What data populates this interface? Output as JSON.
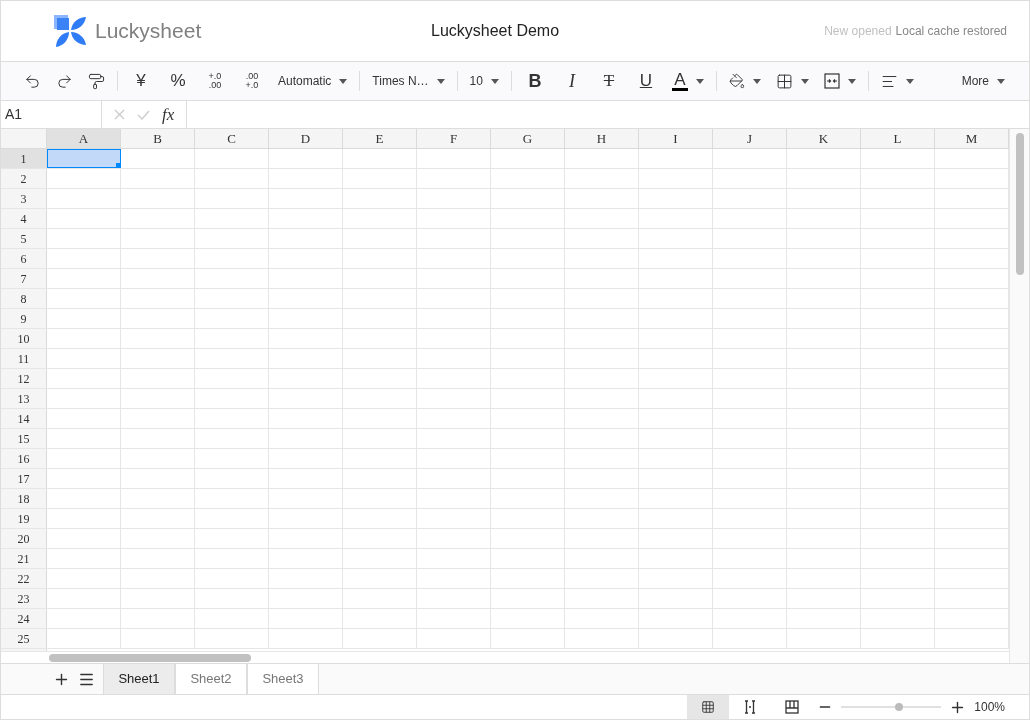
{
  "header": {
    "logo_text": "Luckysheet",
    "title": "Luckysheet Demo",
    "status_muted": "New opened",
    "status": "Local cache restored"
  },
  "toolbar": [
    {
      "kind": "undo"
    },
    {
      "kind": "redo"
    },
    {
      "kind": "painter"
    },
    {
      "kind": "sep"
    },
    {
      "kind": "char",
      "label": "¥"
    },
    {
      "kind": "char",
      "label": "%"
    },
    {
      "kind": "decimal",
      "top": "+.0",
      "bottom": ".00"
    },
    {
      "kind": "decimal",
      "top": ".00",
      "bottom": "+.0"
    },
    {
      "kind": "dropdown",
      "label": "Automatic"
    },
    {
      "kind": "sep"
    },
    {
      "kind": "dropdown",
      "label": "Times N…"
    },
    {
      "kind": "sep"
    },
    {
      "kind": "dropdown",
      "label": "10"
    },
    {
      "kind": "sep"
    },
    {
      "kind": "bold",
      "label": "B"
    },
    {
      "kind": "italic",
      "label": "I"
    },
    {
      "kind": "strike",
      "label": "T"
    },
    {
      "kind": "underline",
      "label": "U"
    },
    {
      "kind": "fontcolor",
      "label": "A",
      "color": "#000000"
    },
    {
      "kind": "sep"
    },
    {
      "kind": "fill"
    },
    {
      "kind": "border"
    },
    {
      "kind": "merge"
    },
    {
      "kind": "sep"
    },
    {
      "kind": "align"
    }
  ],
  "more": "More",
  "formula_bar": {
    "cell_ref": "A1",
    "fx": "fx"
  },
  "columns": [
    {
      "label": "A",
      "selected": true
    },
    {
      "label": "B",
      "selected": false
    },
    {
      "label": "C",
      "selected": false
    },
    {
      "label": "D",
      "selected": false
    },
    {
      "label": "E",
      "selected": false
    },
    {
      "label": "F",
      "selected": false
    },
    {
      "label": "G",
      "selected": false
    },
    {
      "label": "H",
      "selected": false
    },
    {
      "label": "I",
      "selected": false
    },
    {
      "label": "J",
      "selected": false
    },
    {
      "label": "K",
      "selected": false
    },
    {
      "label": "L",
      "selected": false
    },
    {
      "label": "M",
      "selected": false
    }
  ],
  "rows": [
    {
      "label": "1",
      "selected": true
    },
    {
      "label": "2",
      "selected": false
    },
    {
      "label": "3",
      "selected": false
    },
    {
      "label": "4",
      "selected": false
    },
    {
      "label": "5",
      "selected": false
    },
    {
      "label": "6",
      "selected": false
    },
    {
      "label": "7",
      "selected": false
    },
    {
      "label": "8",
      "selected": false
    },
    {
      "label": "9",
      "selected": false
    },
    {
      "label": "10",
      "selected": false
    },
    {
      "label": "11",
      "selected": false
    },
    {
      "label": "12",
      "selected": false
    },
    {
      "label": "13",
      "selected": false
    },
    {
      "label": "14",
      "selected": false
    },
    {
      "label": "15",
      "selected": false
    },
    {
      "label": "16",
      "selected": false
    },
    {
      "label": "17",
      "selected": false
    },
    {
      "label": "18",
      "selected": false
    },
    {
      "label": "19",
      "selected": false
    },
    {
      "label": "20",
      "selected": false
    },
    {
      "label": "21",
      "selected": false
    },
    {
      "label": "22",
      "selected": false
    },
    {
      "label": "23",
      "selected": false
    },
    {
      "label": "24",
      "selected": false
    },
    {
      "label": "25",
      "selected": false
    }
  ],
  "sheets": [
    {
      "label": "Sheet1",
      "selected": true
    },
    {
      "label": "Sheet2",
      "selected": false
    },
    {
      "label": "Sheet3",
      "selected": false
    }
  ],
  "status_bar": {
    "views": [
      {
        "kind": "grid",
        "selected": true
      },
      {
        "kind": "break",
        "selected": false
      },
      {
        "kind": "page",
        "selected": false
      }
    ],
    "zoom": {
      "level": 0.58,
      "reading": "100%"
    }
  }
}
